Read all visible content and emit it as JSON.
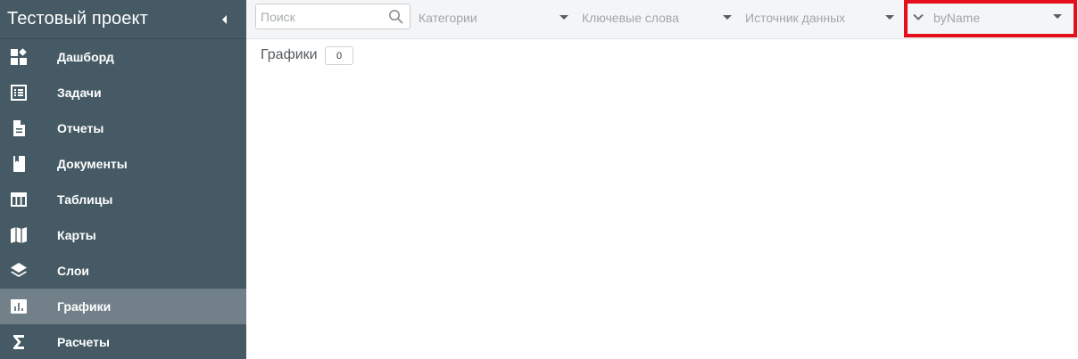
{
  "sidebar": {
    "title": "Тестовый проект",
    "collapse_icon": "caret-left-icon",
    "items": [
      {
        "label": "Дашборд",
        "icon": "dashboard-icon"
      },
      {
        "label": "Задачи",
        "icon": "task-list-icon"
      },
      {
        "label": "Отчеты",
        "icon": "report-icon"
      },
      {
        "label": "Документы",
        "icon": "book-icon"
      },
      {
        "label": "Таблицы",
        "icon": "table-icon"
      },
      {
        "label": "Карты",
        "icon": "map-icon"
      },
      {
        "label": "Слои",
        "icon": "layers-icon"
      },
      {
        "label": "Графики",
        "icon": "bar-chart-icon",
        "active": true
      },
      {
        "label": "Расчеты",
        "icon": "sigma-icon"
      }
    ]
  },
  "topbar": {
    "search": {
      "placeholder": "Поиск",
      "value": ""
    },
    "filters": {
      "categories": "Категории",
      "keywords": "Ключевые слова",
      "data_source": "Источник данных"
    },
    "sort": {
      "value": "byName"
    }
  },
  "main": {
    "section_title": "Графики",
    "count": "0"
  },
  "colors": {
    "sidebar_bg": "#455a64",
    "sidebar_active": "#718089",
    "highlight_border": "#e3101c",
    "topbar_bg": "#f4f5f6"
  }
}
